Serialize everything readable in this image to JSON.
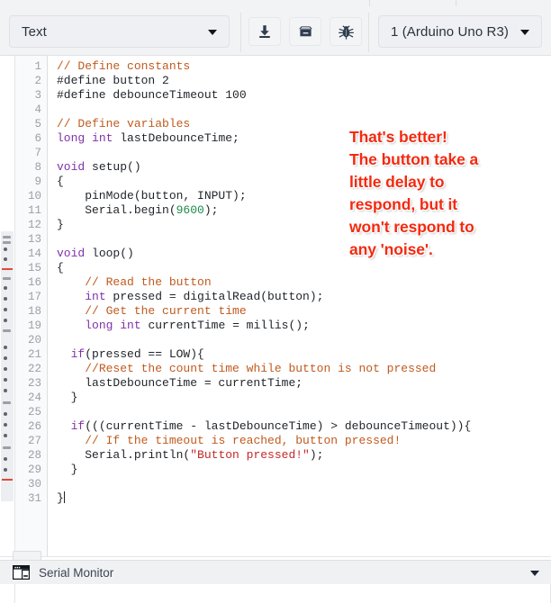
{
  "toolbar": {
    "type_select": {
      "value": "Text",
      "icon": "chevron-down-icon"
    },
    "board_select": {
      "value": "1 (Arduino Uno R3)",
      "icon": "chevron-down-icon"
    },
    "buttons": [
      {
        "name": "upload-button",
        "icon": "download-arrow-icon",
        "label": ""
      },
      {
        "name": "archive-button",
        "icon": "archive-box-icon",
        "label": ""
      },
      {
        "name": "debug-button",
        "icon": "bug-icon",
        "label": ""
      }
    ]
  },
  "editor": {
    "language": "arduino-c",
    "cursor_line": 31,
    "total_lines": 31,
    "line_numbers": [
      1,
      2,
      3,
      4,
      5,
      6,
      7,
      8,
      9,
      10,
      11,
      12,
      13,
      14,
      15,
      16,
      17,
      18,
      19,
      20,
      21,
      22,
      23,
      24,
      25,
      26,
      27,
      28,
      29,
      30,
      31
    ],
    "lines": [
      {
        "n": 1,
        "tokens": [
          {
            "t": "// Define constants",
            "c": "com"
          }
        ]
      },
      {
        "n": 2,
        "tokens": [
          {
            "t": "#define button ",
            "c": "pl"
          },
          {
            "t": "2",
            "c": "pl"
          }
        ]
      },
      {
        "n": 3,
        "tokens": [
          {
            "t": "#define debounceTimeout 100",
            "c": "pl"
          }
        ]
      },
      {
        "n": 4,
        "tokens": []
      },
      {
        "n": 5,
        "tokens": [
          {
            "t": "// Define variables",
            "c": "com"
          }
        ]
      },
      {
        "n": 6,
        "tokens": [
          {
            "t": "long",
            "c": "kw"
          },
          {
            "t": " ",
            "c": "pl"
          },
          {
            "t": "int",
            "c": "kw"
          },
          {
            "t": " lastDebounceTime;",
            "c": "pl"
          }
        ]
      },
      {
        "n": 7,
        "tokens": []
      },
      {
        "n": 8,
        "tokens": [
          {
            "t": "void",
            "c": "kw"
          },
          {
            "t": " setup()",
            "c": "pl"
          }
        ]
      },
      {
        "n": 9,
        "tokens": [
          {
            "t": "{",
            "c": "pl"
          }
        ]
      },
      {
        "n": 10,
        "tokens": [
          {
            "t": "    pinMode(button, INPUT);",
            "c": "pl"
          }
        ]
      },
      {
        "n": 11,
        "tokens": [
          {
            "t": "    Serial.begin(",
            "c": "pl"
          },
          {
            "t": "9600",
            "c": "num"
          },
          {
            "t": ");",
            "c": "pl"
          }
        ]
      },
      {
        "n": 12,
        "tokens": [
          {
            "t": "}",
            "c": "pl"
          }
        ]
      },
      {
        "n": 13,
        "tokens": []
      },
      {
        "n": 14,
        "tokens": [
          {
            "t": "void",
            "c": "kw"
          },
          {
            "t": " loop()",
            "c": "pl"
          }
        ]
      },
      {
        "n": 15,
        "tokens": [
          {
            "t": "{",
            "c": "pl"
          }
        ]
      },
      {
        "n": 16,
        "tokens": [
          {
            "t": "    ",
            "c": "pl"
          },
          {
            "t": "// Read the button",
            "c": "com"
          }
        ]
      },
      {
        "n": 17,
        "tokens": [
          {
            "t": "    ",
            "c": "pl"
          },
          {
            "t": "int",
            "c": "kw"
          },
          {
            "t": " pressed = digitalRead(button);",
            "c": "pl"
          }
        ]
      },
      {
        "n": 18,
        "tokens": [
          {
            "t": "    ",
            "c": "pl"
          },
          {
            "t": "// Get the current time",
            "c": "com"
          }
        ]
      },
      {
        "n": 19,
        "tokens": [
          {
            "t": "    ",
            "c": "pl"
          },
          {
            "t": "long",
            "c": "kw"
          },
          {
            "t": " ",
            "c": "pl"
          },
          {
            "t": "int",
            "c": "kw"
          },
          {
            "t": " currentTime = millis();",
            "c": "pl"
          }
        ]
      },
      {
        "n": 20,
        "tokens": []
      },
      {
        "n": 21,
        "tokens": [
          {
            "t": "  ",
            "c": "pl"
          },
          {
            "t": "if",
            "c": "kw"
          },
          {
            "t": "(pressed == LOW){",
            "c": "pl"
          }
        ]
      },
      {
        "n": 22,
        "tokens": [
          {
            "t": "    ",
            "c": "pl"
          },
          {
            "t": "//Reset the count time while button is not pressed",
            "c": "com"
          }
        ]
      },
      {
        "n": 23,
        "tokens": [
          {
            "t": "    lastDebounceTime = currentTime;",
            "c": "pl"
          }
        ]
      },
      {
        "n": 24,
        "tokens": [
          {
            "t": "  }",
            "c": "pl"
          }
        ]
      },
      {
        "n": 25,
        "tokens": []
      },
      {
        "n": 26,
        "tokens": [
          {
            "t": "  ",
            "c": "pl"
          },
          {
            "t": "if",
            "c": "kw"
          },
          {
            "t": "(((currentTime - lastDebounceTime) > debounceTimeout)){",
            "c": "pl"
          }
        ]
      },
      {
        "n": 27,
        "tokens": [
          {
            "t": "    ",
            "c": "pl"
          },
          {
            "t": "// If the timeout is reached, button pressed!",
            "c": "com"
          }
        ]
      },
      {
        "n": 28,
        "tokens": [
          {
            "t": "    Serial.println(",
            "c": "pl"
          },
          {
            "t": "\"Button pressed!\"",
            "c": "str"
          },
          {
            "t": ");",
            "c": "pl"
          }
        ]
      },
      {
        "n": 29,
        "tokens": [
          {
            "t": "  }",
            "c": "pl"
          }
        ]
      },
      {
        "n": 30,
        "tokens": []
      },
      {
        "n": 31,
        "tokens": [
          {
            "t": "}",
            "c": "pl"
          }
        ]
      }
    ]
  },
  "annotation": {
    "color": "#f32a10",
    "lines": [
      "That's better!",
      "The button take a",
      "little delay to",
      "respond, but it",
      "won't respond to",
      "any 'noise'."
    ]
  },
  "serial_monitor": {
    "title": "Serial Monitor",
    "panel_icon": "window-panel-icon",
    "expand_icon": "chevron-down-icon"
  },
  "colors": {
    "comment": "#c05a1e",
    "keyword": "#7f32a8",
    "number": "#1e8a4c",
    "string": "#c62828",
    "plain": "#1f2328",
    "toolbar_bg": "#f2f3f5",
    "editor_bg": "#ffffff",
    "gutter_bg": "#f9fafb",
    "line_number": "#9aa1a9"
  }
}
